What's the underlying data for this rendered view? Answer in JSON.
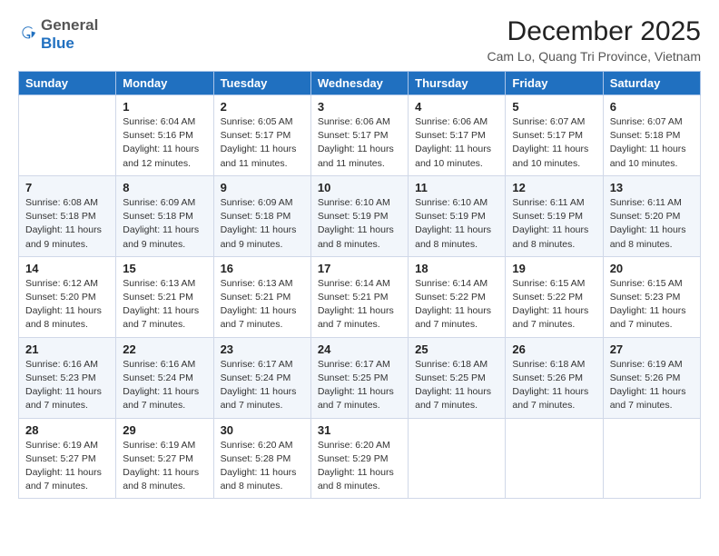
{
  "header": {
    "logo_general": "General",
    "logo_blue": "Blue",
    "main_title": "December 2025",
    "subtitle": "Cam Lo, Quang Tri Province, Vietnam"
  },
  "calendar": {
    "days_of_week": [
      "Sunday",
      "Monday",
      "Tuesday",
      "Wednesday",
      "Thursday",
      "Friday",
      "Saturday"
    ],
    "weeks": [
      [
        {
          "day": "",
          "sunrise": "",
          "sunset": "",
          "daylight": ""
        },
        {
          "day": "1",
          "sunrise": "Sunrise: 6:04 AM",
          "sunset": "Sunset: 5:16 PM",
          "daylight": "Daylight: 11 hours and 12 minutes."
        },
        {
          "day": "2",
          "sunrise": "Sunrise: 6:05 AM",
          "sunset": "Sunset: 5:17 PM",
          "daylight": "Daylight: 11 hours and 11 minutes."
        },
        {
          "day": "3",
          "sunrise": "Sunrise: 6:06 AM",
          "sunset": "Sunset: 5:17 PM",
          "daylight": "Daylight: 11 hours and 11 minutes."
        },
        {
          "day": "4",
          "sunrise": "Sunrise: 6:06 AM",
          "sunset": "Sunset: 5:17 PM",
          "daylight": "Daylight: 11 hours and 10 minutes."
        },
        {
          "day": "5",
          "sunrise": "Sunrise: 6:07 AM",
          "sunset": "Sunset: 5:17 PM",
          "daylight": "Daylight: 11 hours and 10 minutes."
        },
        {
          "day": "6",
          "sunrise": "Sunrise: 6:07 AM",
          "sunset": "Sunset: 5:18 PM",
          "daylight": "Daylight: 11 hours and 10 minutes."
        }
      ],
      [
        {
          "day": "7",
          "sunrise": "Sunrise: 6:08 AM",
          "sunset": "Sunset: 5:18 PM",
          "daylight": "Daylight: 11 hours and 9 minutes."
        },
        {
          "day": "8",
          "sunrise": "Sunrise: 6:09 AM",
          "sunset": "Sunset: 5:18 PM",
          "daylight": "Daylight: 11 hours and 9 minutes."
        },
        {
          "day": "9",
          "sunrise": "Sunrise: 6:09 AM",
          "sunset": "Sunset: 5:18 PM",
          "daylight": "Daylight: 11 hours and 9 minutes."
        },
        {
          "day": "10",
          "sunrise": "Sunrise: 6:10 AM",
          "sunset": "Sunset: 5:19 PM",
          "daylight": "Daylight: 11 hours and 8 minutes."
        },
        {
          "day": "11",
          "sunrise": "Sunrise: 6:10 AM",
          "sunset": "Sunset: 5:19 PM",
          "daylight": "Daylight: 11 hours and 8 minutes."
        },
        {
          "day": "12",
          "sunrise": "Sunrise: 6:11 AM",
          "sunset": "Sunset: 5:19 PM",
          "daylight": "Daylight: 11 hours and 8 minutes."
        },
        {
          "day": "13",
          "sunrise": "Sunrise: 6:11 AM",
          "sunset": "Sunset: 5:20 PM",
          "daylight": "Daylight: 11 hours and 8 minutes."
        }
      ],
      [
        {
          "day": "14",
          "sunrise": "Sunrise: 6:12 AM",
          "sunset": "Sunset: 5:20 PM",
          "daylight": "Daylight: 11 hours and 8 minutes."
        },
        {
          "day": "15",
          "sunrise": "Sunrise: 6:13 AM",
          "sunset": "Sunset: 5:21 PM",
          "daylight": "Daylight: 11 hours and 7 minutes."
        },
        {
          "day": "16",
          "sunrise": "Sunrise: 6:13 AM",
          "sunset": "Sunset: 5:21 PM",
          "daylight": "Daylight: 11 hours and 7 minutes."
        },
        {
          "day": "17",
          "sunrise": "Sunrise: 6:14 AM",
          "sunset": "Sunset: 5:21 PM",
          "daylight": "Daylight: 11 hours and 7 minutes."
        },
        {
          "day": "18",
          "sunrise": "Sunrise: 6:14 AM",
          "sunset": "Sunset: 5:22 PM",
          "daylight": "Daylight: 11 hours and 7 minutes."
        },
        {
          "day": "19",
          "sunrise": "Sunrise: 6:15 AM",
          "sunset": "Sunset: 5:22 PM",
          "daylight": "Daylight: 11 hours and 7 minutes."
        },
        {
          "day": "20",
          "sunrise": "Sunrise: 6:15 AM",
          "sunset": "Sunset: 5:23 PM",
          "daylight": "Daylight: 11 hours and 7 minutes."
        }
      ],
      [
        {
          "day": "21",
          "sunrise": "Sunrise: 6:16 AM",
          "sunset": "Sunset: 5:23 PM",
          "daylight": "Daylight: 11 hours and 7 minutes."
        },
        {
          "day": "22",
          "sunrise": "Sunrise: 6:16 AM",
          "sunset": "Sunset: 5:24 PM",
          "daylight": "Daylight: 11 hours and 7 minutes."
        },
        {
          "day": "23",
          "sunrise": "Sunrise: 6:17 AM",
          "sunset": "Sunset: 5:24 PM",
          "daylight": "Daylight: 11 hours and 7 minutes."
        },
        {
          "day": "24",
          "sunrise": "Sunrise: 6:17 AM",
          "sunset": "Sunset: 5:25 PM",
          "daylight": "Daylight: 11 hours and 7 minutes."
        },
        {
          "day": "25",
          "sunrise": "Sunrise: 6:18 AM",
          "sunset": "Sunset: 5:25 PM",
          "daylight": "Daylight: 11 hours and 7 minutes."
        },
        {
          "day": "26",
          "sunrise": "Sunrise: 6:18 AM",
          "sunset": "Sunset: 5:26 PM",
          "daylight": "Daylight: 11 hours and 7 minutes."
        },
        {
          "day": "27",
          "sunrise": "Sunrise: 6:19 AM",
          "sunset": "Sunset: 5:26 PM",
          "daylight": "Daylight: 11 hours and 7 minutes."
        }
      ],
      [
        {
          "day": "28",
          "sunrise": "Sunrise: 6:19 AM",
          "sunset": "Sunset: 5:27 PM",
          "daylight": "Daylight: 11 hours and 7 minutes."
        },
        {
          "day": "29",
          "sunrise": "Sunrise: 6:19 AM",
          "sunset": "Sunset: 5:27 PM",
          "daylight": "Daylight: 11 hours and 8 minutes."
        },
        {
          "day": "30",
          "sunrise": "Sunrise: 6:20 AM",
          "sunset": "Sunset: 5:28 PM",
          "daylight": "Daylight: 11 hours and 8 minutes."
        },
        {
          "day": "31",
          "sunrise": "Sunrise: 6:20 AM",
          "sunset": "Sunset: 5:29 PM",
          "daylight": "Daylight: 11 hours and 8 minutes."
        },
        {
          "day": "",
          "sunrise": "",
          "sunset": "",
          "daylight": ""
        },
        {
          "day": "",
          "sunrise": "",
          "sunset": "",
          "daylight": ""
        },
        {
          "day": "",
          "sunrise": "",
          "sunset": "",
          "daylight": ""
        }
      ]
    ]
  }
}
